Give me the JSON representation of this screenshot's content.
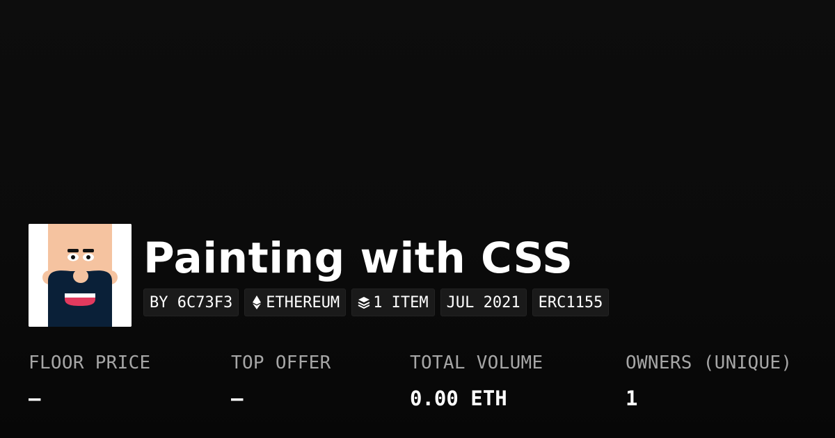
{
  "collection": {
    "title": "Painting with CSS",
    "avatar_icon": "bald-bearded-man-avatar"
  },
  "badges": [
    {
      "label": "BY 6C73F3",
      "icon": null
    },
    {
      "label": "ETHEREUM",
      "icon": "ethereum-icon"
    },
    {
      "label": "1 ITEM",
      "icon": "layers-icon"
    },
    {
      "label": "JUL 2021",
      "icon": null
    },
    {
      "label": "ERC1155",
      "icon": null
    }
  ],
  "stats": [
    {
      "label": "FLOOR PRICE",
      "value": "–"
    },
    {
      "label": "TOP OFFER",
      "value": "–"
    },
    {
      "label": "TOTAL VOLUME",
      "value": "0.00 ETH"
    },
    {
      "label": "OWNERS (UNIQUE)",
      "value": "1"
    }
  ],
  "colors": {
    "background": "#0b0b0b",
    "badge_background": "#1a1a1a",
    "label_gray": "#a6a6a6",
    "avatar_skin": "#f5c3a0",
    "avatar_beard": "#0a2038",
    "avatar_mouth": "#e23a5e"
  }
}
